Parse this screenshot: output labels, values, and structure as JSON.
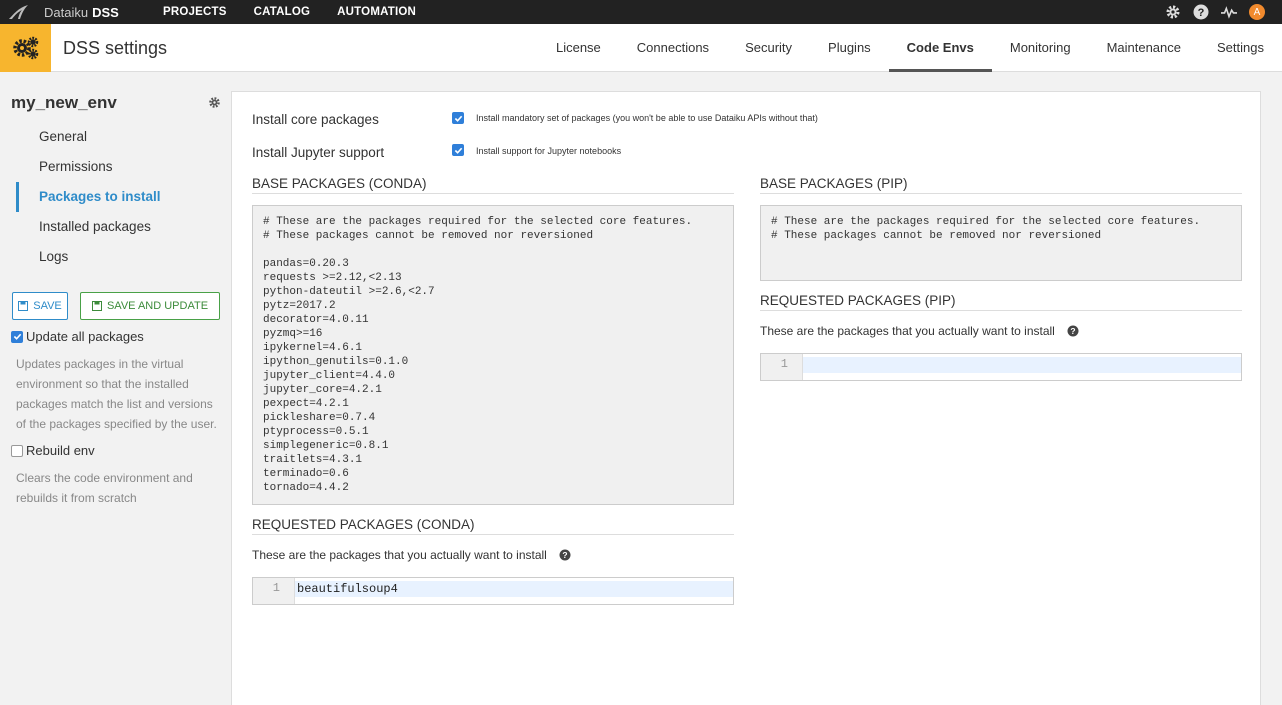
{
  "topbar": {
    "brand_prefix": "Dataiku",
    "brand_strong": "DSS",
    "nav": [
      "PROJECTS",
      "CATALOG",
      "AUTOMATION"
    ],
    "icons": [
      "gear-icon",
      "help-icon",
      "activity-icon"
    ],
    "avatar_letter": "A",
    "avatar_color": "#f18a2d"
  },
  "header": {
    "title": "DSS settings",
    "icon_color": "#f7b52e",
    "tabs": [
      "License",
      "Connections",
      "Security",
      "Plugins",
      "Code Envs",
      "Monitoring",
      "Maintenance",
      "Settings"
    ],
    "active_tab": "Code Envs"
  },
  "sidebar": {
    "env_name": "my_new_env",
    "items": [
      "General",
      "Permissions",
      "Packages to install",
      "Installed packages",
      "Logs"
    ],
    "active_item": "Packages to install",
    "save_label": "SAVE",
    "save_update_label": "SAVE AND UPDATE",
    "update_all": {
      "label": "Update all packages",
      "checked": true,
      "help": "Updates packages in the virtual environment so that the installed packages match the list and versions of the packages specified by the user."
    },
    "rebuild": {
      "label": "Rebuild env",
      "checked": false,
      "help": "Clears the code environment and rebuilds it from scratch"
    }
  },
  "main": {
    "core": {
      "label": "Install core packages",
      "checked": true,
      "text": "Install mandatory set of packages (you won't be able to use Dataiku APIs without that)"
    },
    "jupyter": {
      "label": "Install Jupyter support",
      "checked": true,
      "text": "Install support for Jupyter notebooks"
    },
    "base_conda": {
      "title": "BASE PACKAGES (CONDA)",
      "content": "# These are the packages required for the selected core features.\n# These packages cannot be removed nor reversioned\n\npandas=0.20.3\nrequests >=2.12,<2.13\npython-dateutil >=2.6,<2.7\npytz=2017.2\ndecorator=4.0.11\npyzmq>=16\nipykernel=4.6.1\nipython_genutils=0.1.0\njupyter_client=4.4.0\njupyter_core=4.2.1\npexpect=4.2.1\npickleshare=0.7.4\nptyprocess=0.5.1\nsimplegeneric=0.8.1\ntraitlets=4.3.1\nterminado=0.6\ntornado=4.4.2"
    },
    "base_pip": {
      "title": "BASE PACKAGES (PIP)",
      "content": "# These are the packages required for the selected core features.\n# These packages cannot be removed nor reversioned"
    },
    "req_conda": {
      "title": "REQUESTED PACKAGES (CONDA)",
      "subtitle": "These are the packages that you actually want to install",
      "line_number": "1",
      "content": "beautifulsoup4"
    },
    "req_pip": {
      "title": "REQUESTED PACKAGES (PIP)",
      "subtitle": "These are the packages that you actually want to install",
      "line_number": "1",
      "content": ""
    }
  },
  "colors": {
    "accent": "#2f8cc9",
    "save_update": "#49a147",
    "topbar": "#222222"
  }
}
